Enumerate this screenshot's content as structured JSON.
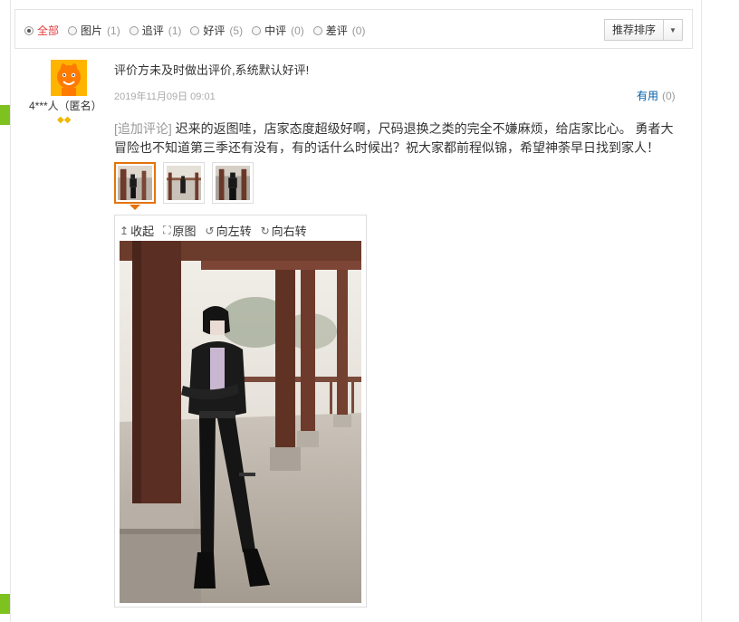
{
  "filters": [
    {
      "label": "全部",
      "count": "",
      "active": true
    },
    {
      "label": "图片",
      "count": "(1)",
      "active": false
    },
    {
      "label": "追评",
      "count": "(1)",
      "active": false
    },
    {
      "label": "好评",
      "count": "(5)",
      "active": false
    },
    {
      "label": "中评",
      "count": "(0)",
      "active": false
    },
    {
      "label": "差评",
      "count": "(0)",
      "active": false
    }
  ],
  "sort": {
    "label": "推荐排序",
    "icon": "caret-down-icon"
  },
  "review": {
    "user_name": "4***人（匿名）",
    "level_icon": "diamond-icon",
    "text": "评价方未及时做出评价,系统默认好评!",
    "date": "2019年11月09日 09:01",
    "useful_label": "有用",
    "useful_count": "(0)",
    "append_tag": "[追加评论]",
    "append_text": " 迟来的返图哇，店家态度超级好啊，尺码退换之类的完全不嫌麻烦，给店家比心。 勇者大冒险也不知道第三季还有没有，有的话什么时候出？祝大家都前程似锦，希望神荼早日找到家人！"
  },
  "viewer": {
    "tools": [
      {
        "icon": "arrow-up-icon",
        "glyph": "↥",
        "label": "收起"
      },
      {
        "icon": "expand-icon",
        "glyph": "⛶",
        "label": "原图"
      },
      {
        "icon": "rotate-left-icon",
        "glyph": "↺",
        "label": "向左转"
      },
      {
        "icon": "rotate-right-icon",
        "glyph": "↻",
        "label": "向右转"
      }
    ]
  },
  "colors": {
    "accent": "#e4393c",
    "link": "#005ea7",
    "thumb_selected": "#e4730c",
    "side_green": "#7dc21e"
  }
}
